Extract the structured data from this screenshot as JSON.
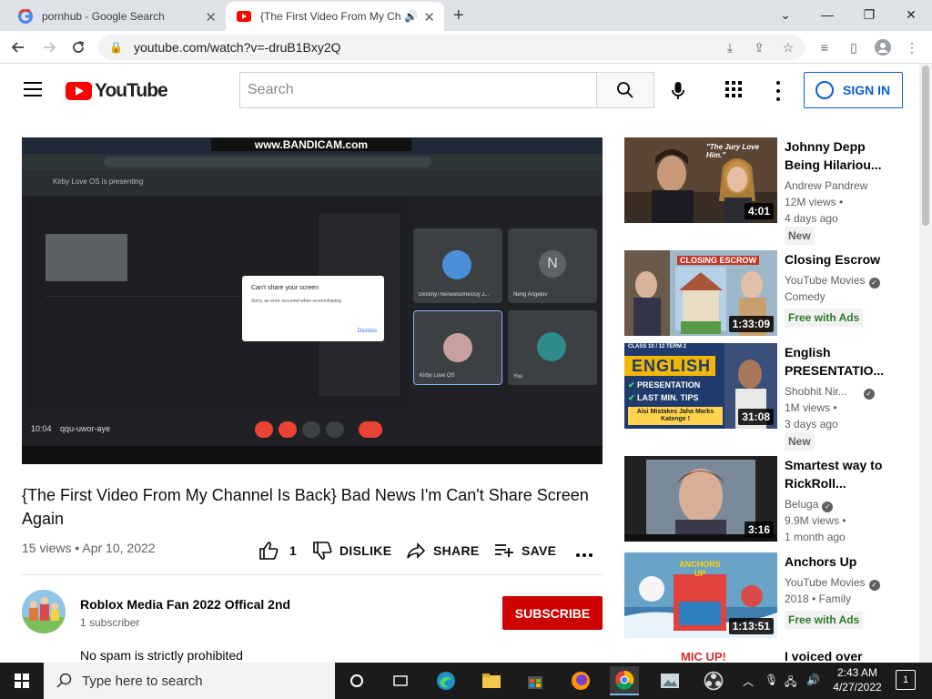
{
  "browser": {
    "tabs": [
      {
        "title": "pornhub - Google Search"
      },
      {
        "title": "{The First Video From My Ch"
      }
    ],
    "url": "youtube.com/watch?v=-druB1Bxy2Q"
  },
  "youtube": {
    "logo_text": "YouTube",
    "search_placeholder": "Search",
    "sign_in": "SIGN IN",
    "video": {
      "title": "{The First Video From My Channel Is Back} Bad News I'm Can't Share Screen Again",
      "meta": "15 views • Apr 10, 2022",
      "likes": "1",
      "dislike": "DISLIKE",
      "share": "SHARE",
      "save": "SAVE",
      "player_time": "10:04",
      "player_code": "qqu-uwor-aye",
      "dialog_title": "Can't share your screen",
      "dialog_body": "Sorry, an error occurred when screensharing",
      "dialog_button": "Dismiss",
      "watermark": "www.BANDICAM.com",
      "presenting": "Kirby Love OS is presenting",
      "tiles": [
        "DestinyTheAwesomeGuy J...",
        "Neng Angelov",
        "Kirby Love OS",
        "You"
      ]
    },
    "channel": {
      "name": "Roblox Media Fan 2022 Offical 2nd",
      "subscribers": "1 subscriber",
      "subscribe": "SUBSCRIBE",
      "description": "No spam is strictly prohibited"
    },
    "recommendations": [
      {
        "title": "Johnny Depp Being Hilariou...",
        "channel": "Andrew Pandrew",
        "line2": "12M views •",
        "line3": "4 days ago",
        "badge": "New",
        "duration": "4:01",
        "thumb_caption": "\"The Jury Love Him.\""
      },
      {
        "title": "Closing Escrow",
        "channel": "YouTube Movies",
        "line2": "Comedy",
        "badge": "Free with Ads",
        "duration": "1:33:09",
        "thumb_caption": "CLOSING ESCROW"
      },
      {
        "title": "English PRESENTATIO...",
        "channel": "Shobhit Nir...",
        "line2": "1M views •",
        "line3": "3 days ago",
        "badge": "New",
        "duration": "31:08",
        "thumb_caption": "ENGLISH",
        "thumb_lines": [
          "CLASS 10 / 12 TERM 2",
          "PRESENTATION",
          "LAST MIN. TIPS",
          "Aisi Mistakes Jaha Marks Katenge !"
        ]
      },
      {
        "title": "Smartest way to RickRoll...",
        "channel": "Beluga",
        "line2": "9.9M views •",
        "line3": "1 month ago",
        "duration": "3:16"
      },
      {
        "title": "Anchors Up",
        "channel": "YouTube Movies",
        "line2": "2018 • Family",
        "badge": "Free with Ads",
        "duration": "1:13:51",
        "thumb_caption": "ANCHORS UP"
      },
      {
        "title": "I voiced over",
        "thumb_caption": "MIC UP!"
      }
    ]
  },
  "taskbar": {
    "search_placeholder": "Type here to search",
    "time": "2:43 AM",
    "date": "4/27/2022",
    "notifications": "1"
  },
  "colors": {
    "yt_red": "#ff0000",
    "subscribe_red": "#cc0000",
    "link_blue": "#065fd4"
  }
}
